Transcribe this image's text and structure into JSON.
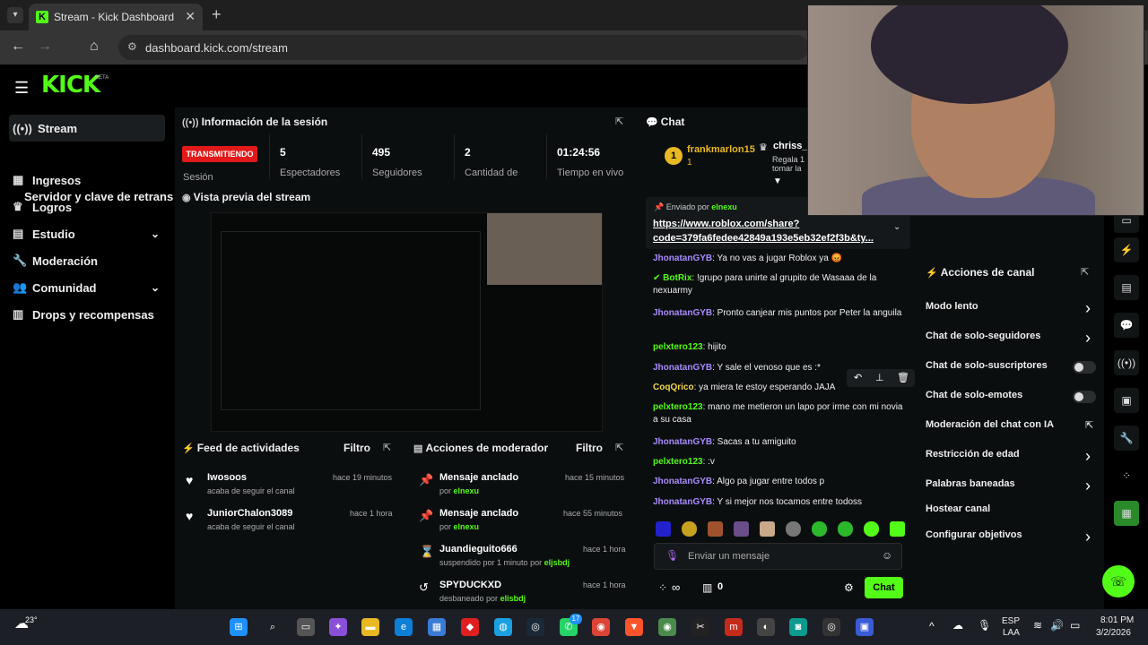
{
  "browser": {
    "tab_title": "Stream - Kick Dashboard",
    "url": "dashboard.kick.com/stream"
  },
  "logo": {
    "text": "KICK",
    "beta": "BETA"
  },
  "sidebar": {
    "items": [
      {
        "label": "Stream",
        "icon": "broadcast-icon"
      },
      {
        "label": "Ingresos",
        "icon": "chart-icon"
      },
      {
        "label": "Logros",
        "icon": "trophy-icon"
      },
      {
        "label": "Estudio",
        "icon": "layers-icon"
      },
      {
        "label": "Moderación",
        "icon": "wrench-icon"
      },
      {
        "label": "Comunidad",
        "icon": "people-icon"
      },
      {
        "label": "Drops y recompensas",
        "icon": "gift-icon"
      }
    ],
    "sub_item": "Servidor y clave de retransm"
  },
  "session": {
    "title": "Información de la sesión",
    "badge": "TRANSMITIENDO",
    "badge_label": "Sesión",
    "stats": [
      {
        "value": "5",
        "label": "Espectadores"
      },
      {
        "value": "495",
        "label": "Seguidores"
      },
      {
        "value": "2",
        "label": "Cantidad de"
      },
      {
        "value": "01:24:56",
        "label": "Tiempo en vivo"
      }
    ]
  },
  "preview": {
    "title": "Vista previa del stream"
  },
  "activity": {
    "title": "Feed de actividades",
    "filter": "Filtro",
    "items": [
      {
        "name": "Iwosoos",
        "sub": "acaba de seguir el canal",
        "time": "hace 19 minutos"
      },
      {
        "name": "JuniorChalon3089",
        "sub": "acaba de seguir el canal",
        "time": "hace 1 hora"
      }
    ]
  },
  "modactions": {
    "title": "Acciones de moderador",
    "filter": "Filtro",
    "items": [
      {
        "title": "Mensaje anclado",
        "sub_prefix": "por ",
        "sub_user": "elnexu",
        "time": "hace 15 minutos"
      },
      {
        "title": "Mensaje anclado",
        "sub_prefix": "por ",
        "sub_user": "elnexu",
        "time": "hace 55 minutos"
      },
      {
        "title": "Juandieguito666",
        "sub_prefix": "suspendido por 1 minuto por ",
        "sub_user": "eljsbdj",
        "time": "hace 1 hora"
      },
      {
        "title": "SPYDUCKXD",
        "sub_prefix": "desbaneado por ",
        "sub_user": "elisbdj",
        "time": "hace 1 hora"
      }
    ]
  },
  "chat": {
    "title": "Chat",
    "top_gifter": {
      "rank": "1",
      "name": "frankmarlon15",
      "count": "1"
    },
    "second": {
      "name": "chriss_",
      "line1": "Regala 1",
      "line2": "tomar la"
    },
    "pinned": {
      "label": "Enviado por",
      "user": "elnexu",
      "link_line1": "https://www.roblox.com/share?",
      "link_line2": "code=379fa6fedee42849a193e5eb32ef2f3b&ty..."
    },
    "messages": [
      {
        "user": "JhonatanGYB",
        "color": "u-purple",
        "text": " Ya no vas a jugar Roblox ya 😡"
      },
      {
        "user": "BotRix",
        "color": "u-green",
        "text": " !grupo para unirte al grupito de Wasaaa de la nexuarmy"
      },
      {
        "user": "JhonatanGYB",
        "color": "u-purple",
        "text": " Pronto canjear mis puntos por Peter la anguila"
      },
      {
        "user": "pelxtero123",
        "color": "u-green",
        "text": " hijito"
      },
      {
        "user": "JhonatanGYB",
        "color": "u-purple",
        "text": " Y sale el venoso que es :*"
      },
      {
        "user": "CoqQrico",
        "color": "u-yellow",
        "text": " ya miera te estoy esperando JAJA"
      },
      {
        "user": "pelxtero123",
        "color": "u-green",
        "text": " mano me metieron un lapo por irme con mi novia a su casa"
      },
      {
        "user": "JhonatanGYB",
        "color": "u-purple",
        "text": " Sacas a tu amiguito"
      },
      {
        "user": "pelxtero123",
        "color": "u-green",
        "text": " :v"
      },
      {
        "user": "JhonatanGYB",
        "color": "u-purple",
        "text": " Algo pa jugar entre todos p"
      },
      {
        "user": "JhonatanGYB",
        "color": "u-purple",
        "text": " Y si mejor nos tocamos entre todoss"
      }
    ],
    "input_placeholder": "Enviar un mensaje",
    "points": "∞",
    "count": "0",
    "send_label": "Chat"
  },
  "channel_actions": {
    "title": "Acciones de canal",
    "items": [
      {
        "label": "Modo lento",
        "control": "chevron"
      },
      {
        "label": "Chat de solo-seguidores",
        "control": "chevron"
      },
      {
        "label": "Chat de solo-suscriptores",
        "control": "toggle"
      },
      {
        "label": "Chat de solo-emotes",
        "control": "toggle"
      },
      {
        "label": "Moderación del chat con IA",
        "control": "external"
      },
      {
        "label": "Restricción de edad",
        "control": "chevron"
      },
      {
        "label": "Palabras baneadas",
        "control": "chevron"
      },
      {
        "label": "Hostear canal",
        "control": "none"
      },
      {
        "label": "Configurar objetivos",
        "control": "chevron"
      }
    ]
  },
  "taskbar": {
    "temp": "23°",
    "lang1": "ESP",
    "lang2": "LAA",
    "time": "8:01 PM",
    "date": "3/2/2026",
    "whatsapp_badge": "17"
  },
  "colors": {
    "kick_green": "#53fc18",
    "live_red": "#e11919",
    "bg": "#0b0e0f"
  }
}
